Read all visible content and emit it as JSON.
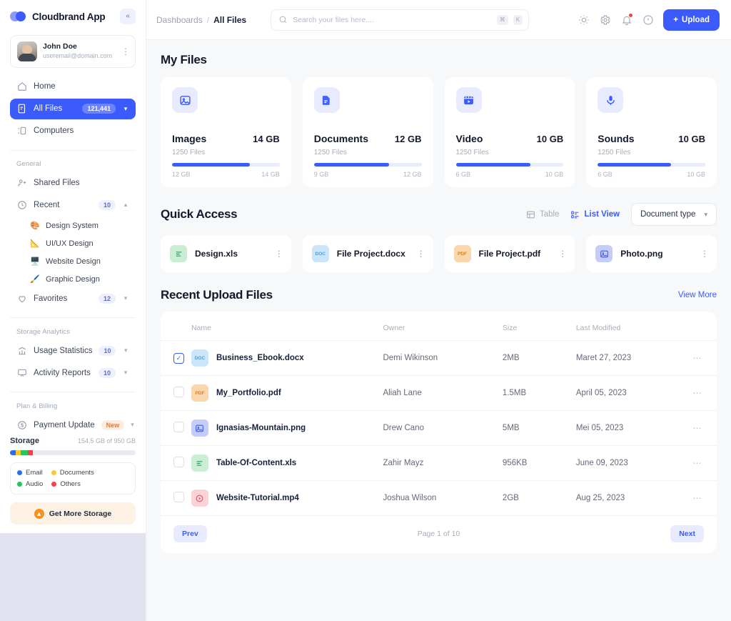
{
  "sidebar": {
    "brand": "Cloudbrand App",
    "collapse_icon": "chevrons-left-icon",
    "user": {
      "name": "John Doe",
      "email": "useremail@domain.com"
    },
    "nav_primary": [
      {
        "label": "Home",
        "icon": "home-icon"
      },
      {
        "label": "All Files",
        "icon": "files-icon",
        "badge": "121,441",
        "chevron": "chevron-down-icon",
        "active": true
      },
      {
        "label": "Computers",
        "icon": "computer-icon"
      }
    ],
    "general_title": "General",
    "nav_general": [
      {
        "label": "Shared Files",
        "icon": "shared-users-icon"
      },
      {
        "label": "Recent",
        "icon": "clock-icon",
        "badge": "10",
        "chevron": "chevron-up-icon"
      }
    ],
    "recent_children": [
      {
        "label": "Design System",
        "emoji": "🎨"
      },
      {
        "label": "UI/UX Design",
        "emoji": "📐"
      },
      {
        "label": "Website Design",
        "emoji": "🖥️"
      },
      {
        "label": "Graphic Design",
        "emoji": "🖌️"
      }
    ],
    "favorites": {
      "label": "Favorites",
      "icon": "heart-icon",
      "badge": "12",
      "chevron": "chevron-down-icon"
    },
    "analytics_title": "Storage Analytics",
    "nav_analytics": [
      {
        "label": "Usage Statistics",
        "icon": "bar-chart-icon",
        "badge": "10",
        "chevron": "chevron-down-icon"
      },
      {
        "label": "Activity Reports",
        "icon": "presentation-icon",
        "badge": "10",
        "chevron": "chevron-down-icon"
      }
    ],
    "billing_title": "Plan & Billing",
    "nav_billing": [
      {
        "label": "Payment Update",
        "icon": "dollar-circle-icon",
        "badge": "New",
        "chevron": "chevron-down-icon"
      }
    ],
    "storage": {
      "title": "Storage",
      "usage": "154,5 GB of 950 GB",
      "segments": [
        {
          "label": "Email",
          "color": "#2f6bf2",
          "pct": 4.5
        },
        {
          "label": "Documents",
          "color": "#f5c93c",
          "pct": 4.2
        },
        {
          "label": "Audio",
          "color": "#27c45f",
          "pct": 5.3
        },
        {
          "label": "Others",
          "color": "#f4404a",
          "pct": 4.0
        }
      ],
      "legend": [
        {
          "label": "Email",
          "color": "#2f6bf2"
        },
        {
          "label": "Documents",
          "color": "#f5c93c"
        },
        {
          "label": "Audio",
          "color": "#27c45f"
        },
        {
          "label": "Others",
          "color": "#f4404a"
        }
      ],
      "cta": "Get More Storage",
      "cta_icon": "arrow-up-circle-icon"
    }
  },
  "topbar": {
    "breadcrumb_root": "Dashboards",
    "breadcrumb_sep": "/",
    "breadcrumb_current": "All Files",
    "search": {
      "placeholder": "Search your files here....",
      "value": "",
      "icon": "search-icon",
      "kbd1": "⌘",
      "kbd2": "K"
    },
    "icons": [
      {
        "name": "sun-icon"
      },
      {
        "name": "gear-icon"
      },
      {
        "name": "bell-icon",
        "dot": true
      },
      {
        "name": "help-circle-icon"
      }
    ],
    "upload_label": "Upload",
    "upload_icon": "plus-icon",
    "accent": "#3b5bfd"
  },
  "my_files": {
    "title": "My Files",
    "cards": [
      {
        "name": "Images",
        "size": "14 GB",
        "files": "1250 Files",
        "used": "12 GB",
        "total": "14 GB",
        "pct": 72,
        "icon": "image-icon"
      },
      {
        "name": "Documents",
        "size": "12 GB",
        "files": "1250 Files",
        "used": "9 GB",
        "total": "12 GB",
        "pct": 70,
        "icon": "document-icon"
      },
      {
        "name": "Video",
        "size": "10 GB",
        "files": "1250 Files",
        "used": "6 GB",
        "total": "10 GB",
        "pct": 69,
        "icon": "video-icon"
      },
      {
        "name": "Sounds",
        "size": "10 GB",
        "files": "1250 Files",
        "used": "6 GB",
        "total": "10 GB",
        "pct": 68,
        "icon": "microphone-icon"
      }
    ]
  },
  "quick_access": {
    "title": "Quick Access",
    "table_label": "Table",
    "table_icon": "table-icon",
    "list_label": "List View",
    "list_icon": "list-icon",
    "filter_label": "Document type",
    "filter_chevron": "chevron-down-icon",
    "items": [
      {
        "name": "Design.xls",
        "kind": "XLS",
        "bg": "#c9eed4",
        "fg": "#27a05a",
        "icon": "xls-icon"
      },
      {
        "name": "File Project.docx",
        "kind": "DOC",
        "bg": "#cbe6fb",
        "fg": "#4b9ddf",
        "icon": "doc-icon"
      },
      {
        "name": "File Project.pdf",
        "kind": "PDF",
        "bg": "#f9d6ac",
        "fg": "#d88324",
        "icon": "pdf-icon"
      },
      {
        "name": "Photo.png",
        "kind": "PNG",
        "bg": "#c3cdf8",
        "fg": "#3b5bfd",
        "icon": "image-icon"
      }
    ]
  },
  "recent_uploads": {
    "title": "Recent Upload Files",
    "view_more": "View More",
    "columns": [
      "Name",
      "Owner",
      "Size",
      "Last Modified"
    ],
    "rows": [
      {
        "name": "Business_Ebook.docx",
        "owner": "Demi Wikinson",
        "size": "2MB",
        "modified": "Maret 27, 2023",
        "checked": true,
        "kind": "DOC",
        "bg": "#cbe6fb",
        "fg": "#4b9ddf",
        "icon": "doc-icon"
      },
      {
        "name": "My_Portfolio.pdf",
        "owner": "Aliah Lane",
        "size": "1.5MB",
        "modified": "April 05, 2023",
        "checked": false,
        "kind": "PDF",
        "bg": "#f9d6ac",
        "fg": "#d88324",
        "icon": "pdf-icon"
      },
      {
        "name": "Ignasias-Mountain.png",
        "owner": "Drew Cano",
        "size": "5MB",
        "modified": "Mei 05, 2023",
        "checked": false,
        "kind": "PNG",
        "bg": "#c3cdf8",
        "fg": "#3b5bfd",
        "icon": "image-icon"
      },
      {
        "name": "Table-Of-Content.xls",
        "owner": "Zahir Mayz",
        "size": "956KB",
        "modified": "June 09, 2023",
        "checked": false,
        "kind": "XLS",
        "bg": "#c9eed4",
        "fg": "#27a05a",
        "icon": "xls-icon"
      },
      {
        "name": "Website-Tutorial.mp4",
        "owner": "Joshua Wilson",
        "size": "2GB",
        "modified": "Aug 25, 2023",
        "checked": false,
        "kind": "MP4",
        "bg": "#fbd3d7",
        "fg": "#ef4a5c",
        "icon": "video-play-icon"
      }
    ],
    "row_menu_icon": "kebab-horizontal-icon",
    "pagination": {
      "prev": "Prev",
      "info": "Page 1 of 10",
      "next": "Next"
    }
  }
}
